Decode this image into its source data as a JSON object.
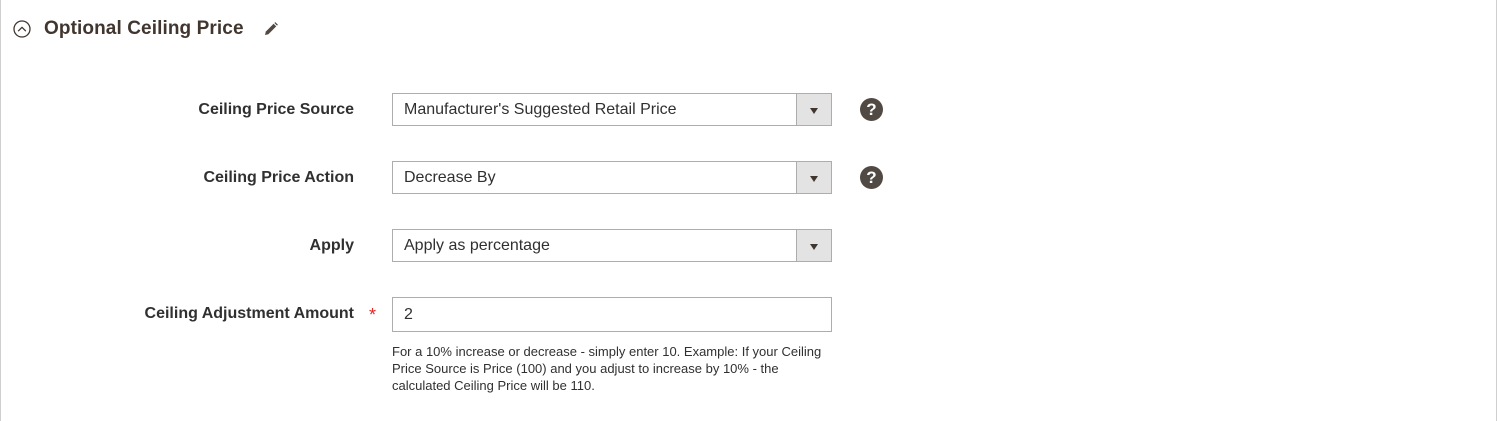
{
  "section": {
    "title": "Optional Ceiling Price",
    "collapse_icon": "chevron-up-circle-icon",
    "edit_icon": "pencil-icon"
  },
  "fields": {
    "ceiling_price_source": {
      "label": "Ceiling Price Source",
      "value": "Manufacturer's Suggested Retail Price",
      "help_icon": "?"
    },
    "ceiling_price_action": {
      "label": "Ceiling Price Action",
      "value": "Decrease By",
      "help_icon": "?"
    },
    "apply": {
      "label": "Apply",
      "value": "Apply as percentage"
    },
    "ceiling_adjustment_amount": {
      "label": "Ceiling Adjustment Amount",
      "required_mark": "*",
      "value": "2",
      "note": "For a 10% increase or decrease - simply enter 10. Example: If your Ceiling Price Source is Price (100) and you adjust to increase by 10% - the calculated Ceiling Price will be 110."
    }
  },
  "colors": {
    "title": "#41362f",
    "help_icon_bg": "#514943",
    "required": "#e22626",
    "select_button_bg": "#e3e3e3",
    "border": "#adadad"
  }
}
